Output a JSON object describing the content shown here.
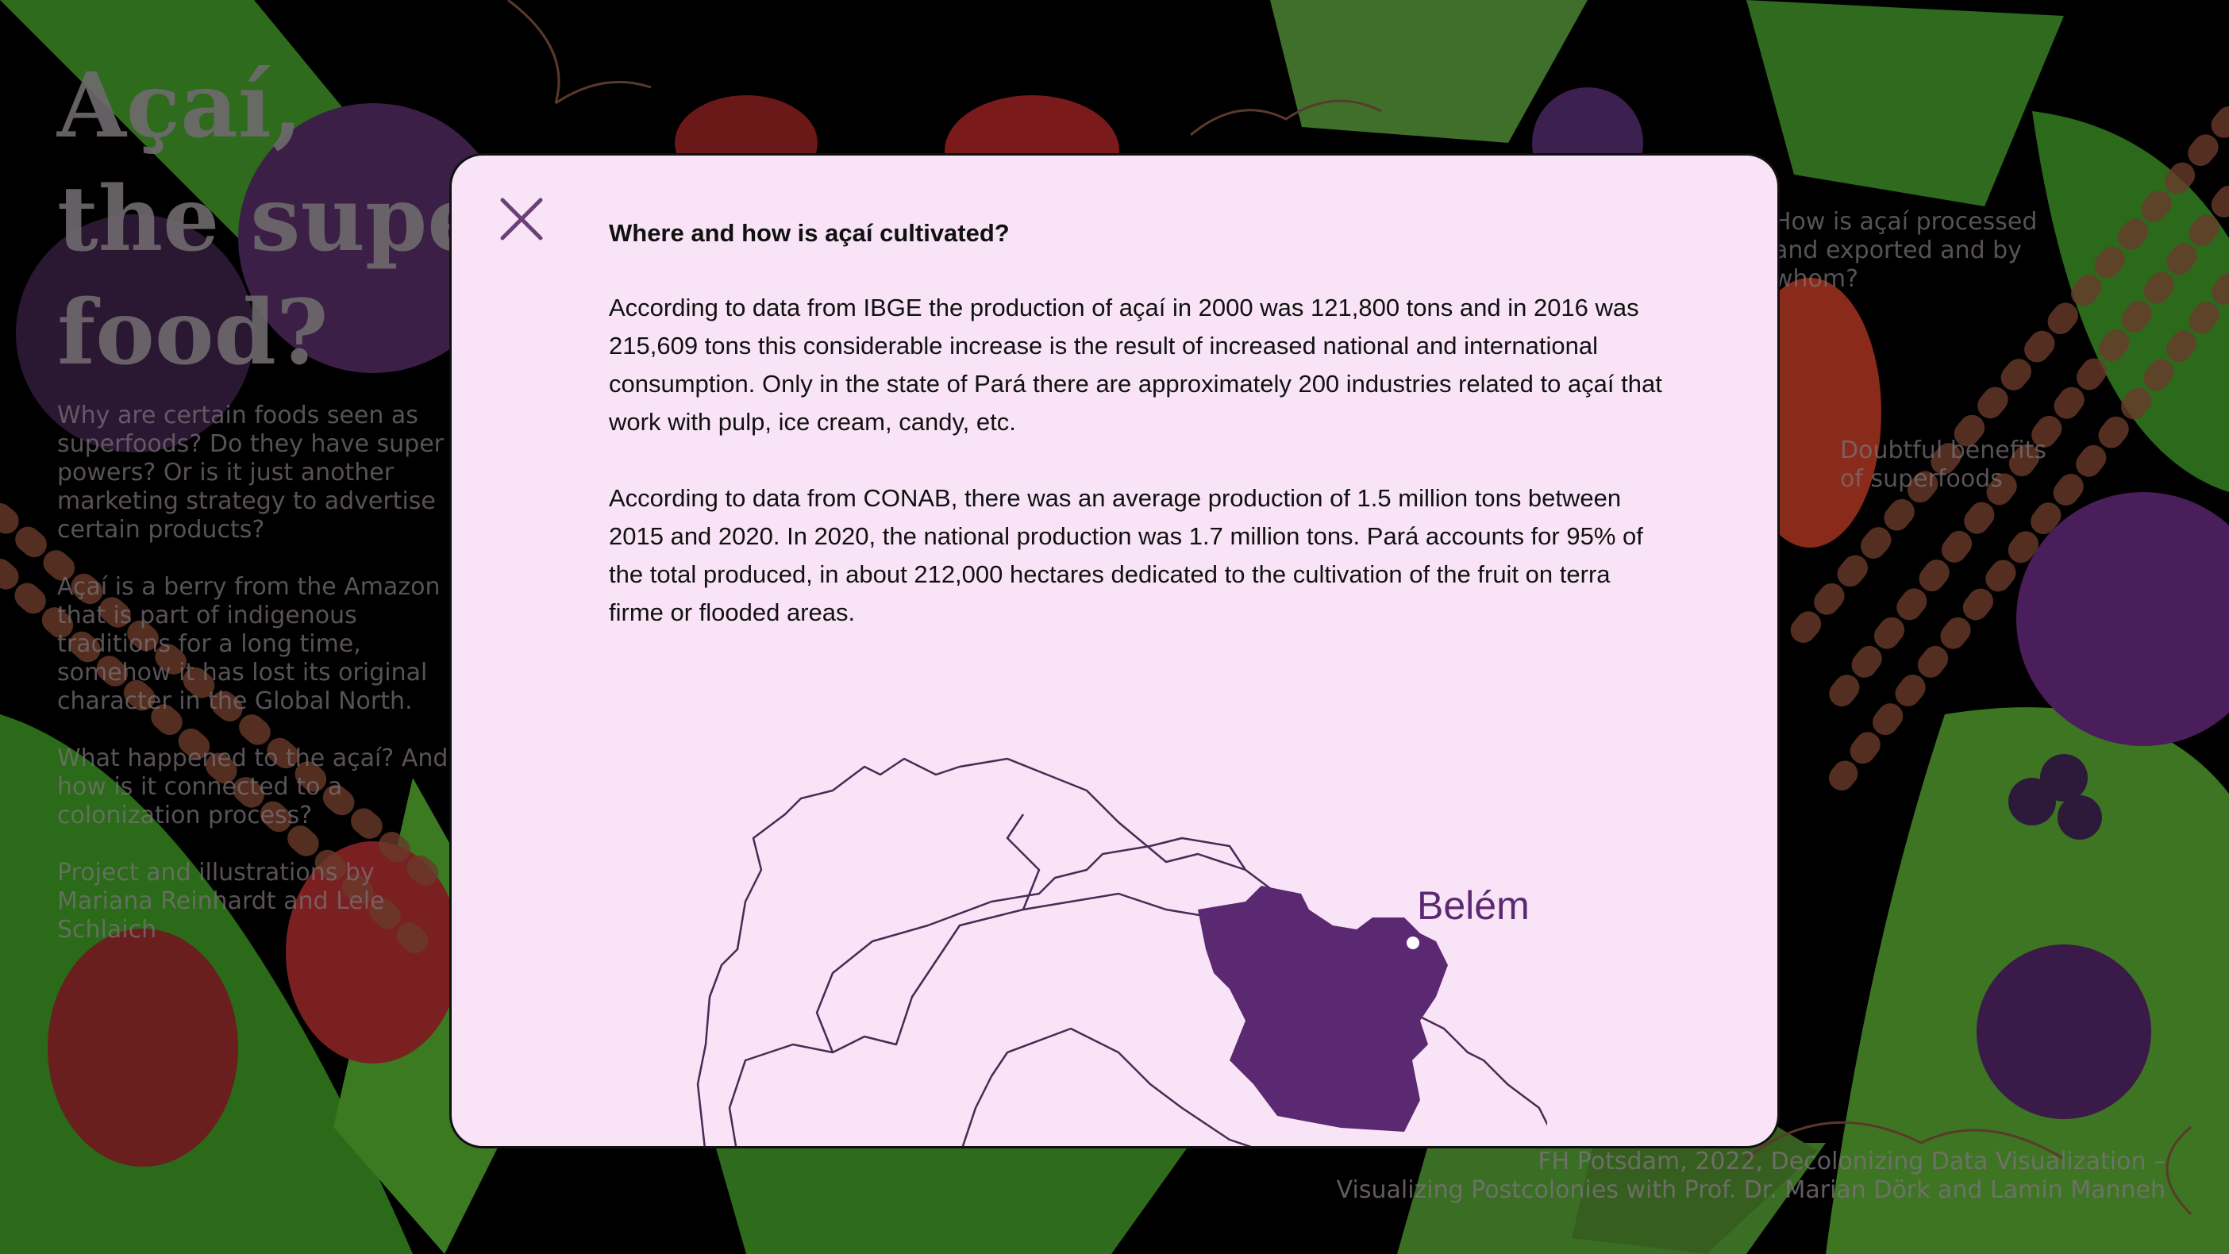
{
  "page": {
    "hero_title": "Açaí,\nthe super\nfood?",
    "intro": {
      "p1": "Why are certain foods seen as superfoods? Do they have super powers? Or is it just another marketing strategy to advertise certain products?",
      "p2": "Açaí is a berry from the Amazon that is part of indigenous traditions for a long time, somehow it has lost its original character in the Global North.",
      "p3": "What happened to the açaí? And how is it connected to a colonization process?",
      "p4": "Project and illustrations by\nMariana Reinhardt and Lele Schlaich"
    },
    "side_links": {
      "processed": "How is açaí processed\nand exported and by\nwhom?",
      "benefits": "Doubtful benefits\nof superfoods"
    },
    "footer": "FH Potsdam, 2022, Decolonizing Data Visualization –\nVisualizing Postcolonies with Prof. Dr. Marian Dörk and Lamin Manneh"
  },
  "modal": {
    "title": "Where and how is açaí cultivated?",
    "paragraph_1": "According to data from IBGE the production of açaí in 2000 was 121,800 tons and in 2016 was 215,609 tons this considerable increase is the result of increased national and international consumption. Only in the state of Pará there are approximately 200 industries related to açaí that work with pulp, ice cream, candy, etc.",
    "paragraph_2": "According to data from CONAB, there was an average production of 1.5 million tons between 2015 and 2020. In 2020, the national production was 1.7 million tons. Pará accounts for 95% of the total produced, in about 212,000 hectares dedicated to the cultivation of the fruit on terra firme or flooded areas.",
    "map": {
      "city_label": "Belém",
      "highlight_color": "#5b2872",
      "outline_color": "#4a2a55",
      "close_icon": "close-icon"
    }
  }
}
